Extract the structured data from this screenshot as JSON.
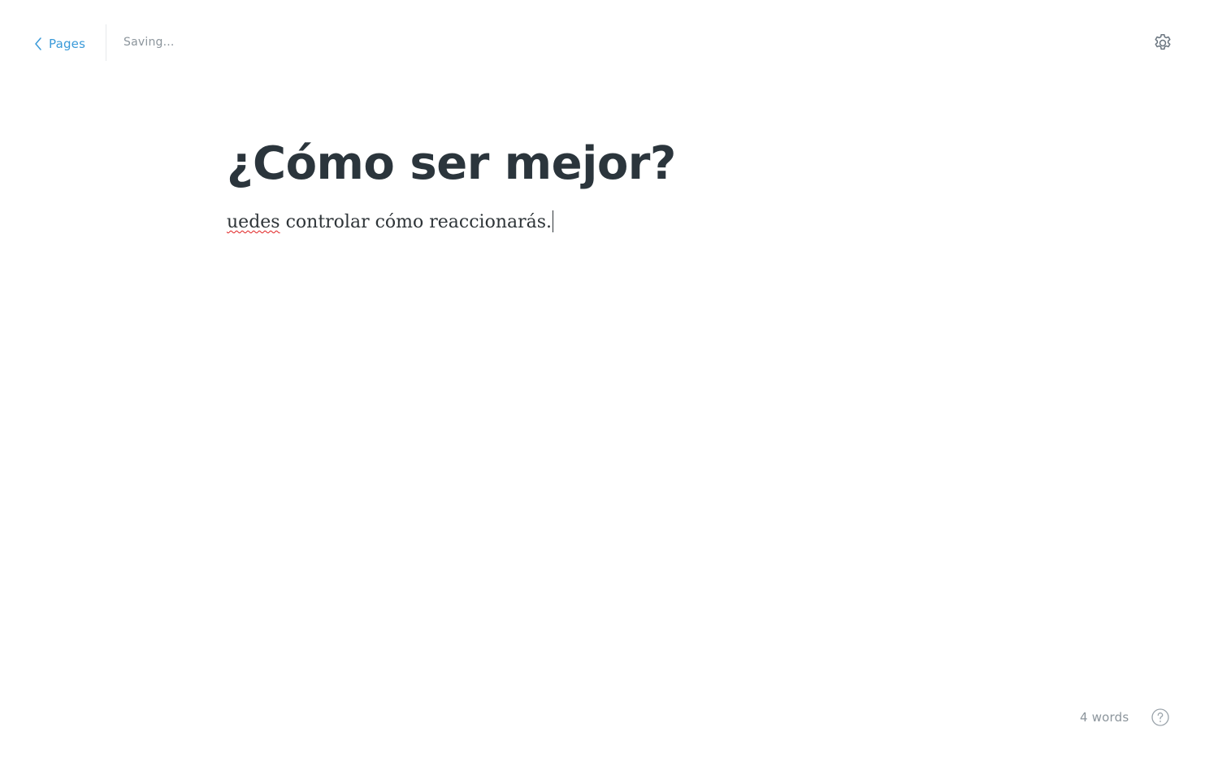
{
  "topbar": {
    "back_label": "Pages",
    "back_icon": "chevron-left-icon",
    "status": "Saving...",
    "settings_icon": "gear-icon"
  },
  "document": {
    "title": "¿Cómo ser mejor?",
    "body_misspelled_word": "uedes",
    "body_rest": " controlar cómo reaccionarás."
  },
  "footer": {
    "word_count": "4 words",
    "help_icon": "question-circle-icon"
  },
  "colors": {
    "accent": "#3a9ad9",
    "title": "#2b353c",
    "body_text": "#2e3438",
    "muted": "#8c959c",
    "spellcheck_underline": "#e02020"
  }
}
